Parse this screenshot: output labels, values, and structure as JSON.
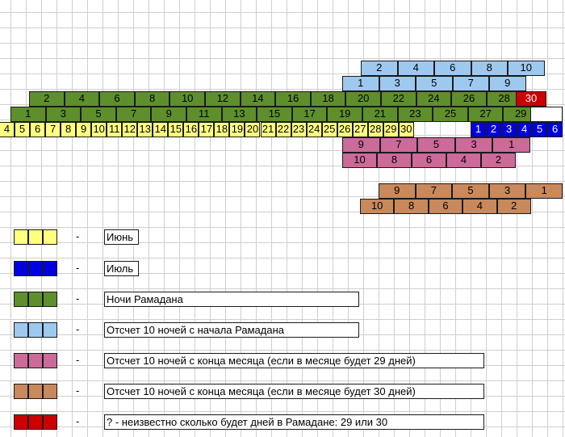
{
  "colors": {
    "june": "#ffff80",
    "july": "#0000e0",
    "ramadan": "#5e8f2c",
    "start10": "#9ec9ef",
    "end29": "#cc6a9a",
    "end30": "#c8895c",
    "unknown": "#cc0000"
  },
  "rows": {
    "blue_top": [
      "2",
      "4",
      "6",
      "8",
      "10"
    ],
    "blue_bottom": [
      "1",
      "3",
      "5",
      "7",
      "9"
    ],
    "green_even": [
      "2",
      "4",
      "6",
      "8",
      "10",
      "12",
      "14",
      "16",
      "18",
      "20",
      "22",
      "24",
      "26",
      "28"
    ],
    "unknown_cell": "30",
    "green_odd": [
      "1",
      "3",
      "5",
      "7",
      "9",
      "11",
      "13",
      "15",
      "17",
      "19",
      "21",
      "23",
      "25",
      "27",
      "29"
    ],
    "june_days": [
      "4",
      "5",
      "6",
      "7",
      "8",
      "9",
      "10",
      "11",
      "12",
      "13",
      "14",
      "15",
      "16",
      "17",
      "18",
      "19",
      "20",
      "21",
      "22",
      "23",
      "24",
      "25",
      "26",
      "27",
      "28",
      "29",
      "30"
    ],
    "july_days": [
      "1",
      "2",
      "3",
      "4",
      "5",
      "6"
    ],
    "pink_odd": [
      "9",
      "7",
      "5",
      "3",
      "1"
    ],
    "pink_even": [
      "10",
      "8",
      "6",
      "4",
      "2"
    ],
    "brown_odd": [
      "9",
      "7",
      "5",
      "3",
      "1"
    ],
    "brown_even": [
      "10",
      "8",
      "6",
      "4",
      "2"
    ]
  },
  "legend": [
    {
      "key": "june",
      "dash": "-",
      "label": "Июнь"
    },
    {
      "key": "july",
      "dash": "-",
      "label": "Июль"
    },
    {
      "key": "ramadan",
      "dash": "-",
      "label": "Ночи Рамадана"
    },
    {
      "key": "start10",
      "dash": "-",
      "label": "Отсчет 10 ночей с начала Рамадана"
    },
    {
      "key": "end29",
      "dash": "-",
      "label": "Отсчет 10 ночей с конца месяца (если в месяце будет 29 дней)"
    },
    {
      "key": "end30",
      "dash": "-",
      "label": "Отсчет 10 ночей с конца месяца (если в месяце будет 30 дней)"
    },
    {
      "key": "unknown",
      "dash": "-",
      "label": "? - неизвестно сколько будет дней в Рамадане: 29 или 30"
    }
  ]
}
